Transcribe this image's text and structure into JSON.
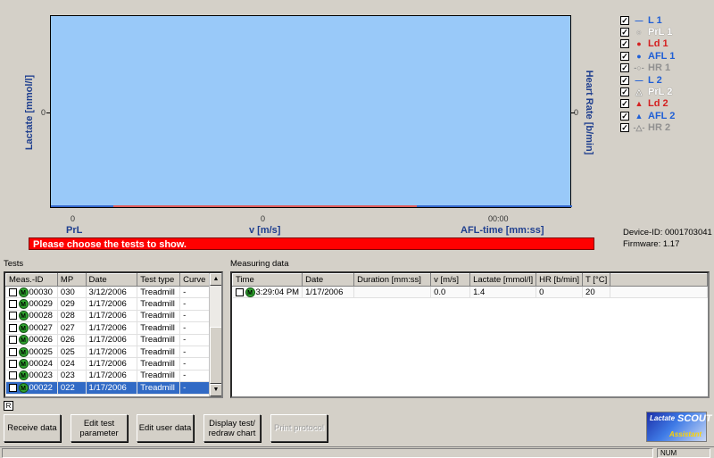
{
  "chart": {
    "ylabel_left": "Lactate [mmol/l]",
    "ylabel_right": "Heart Rate [b/min]",
    "ytick_left": "0",
    "ytick_right": "0",
    "x_axes": [
      {
        "tick": "0",
        "label": "PrL"
      },
      {
        "tick": "0",
        "label": "v [m/s]"
      },
      {
        "tick": "00:00",
        "label": "AFL-time [mm:ss]"
      }
    ],
    "message": "Please choose the tests to show.",
    "colors": {
      "plot_bg": "#99c9f9",
      "message_bg": "#ff0000"
    }
  },
  "legend": [
    {
      "label": "L 1",
      "symbol": "—",
      "color": "#1f5fd6"
    },
    {
      "label": "PrL 1",
      "symbol": "○",
      "color": "#ffffff"
    },
    {
      "label": "Ld 1",
      "symbol": "●",
      "color": "#d42020"
    },
    {
      "label": "AFL 1",
      "symbol": "●",
      "color": "#1f5fd6"
    },
    {
      "label": "HR 1",
      "symbol": "-○-",
      "color": "#909090"
    },
    {
      "label": "L 2",
      "symbol": "—",
      "color": "#1f5fd6"
    },
    {
      "label": "PrL 2",
      "symbol": "△",
      "color": "#ffffff"
    },
    {
      "label": "Ld 2",
      "symbol": "▲",
      "color": "#d42020"
    },
    {
      "label": "AFL 2",
      "symbol": "▲",
      "color": "#1f5fd6"
    },
    {
      "label": "HR 2",
      "symbol": "-△-",
      "color": "#909090"
    }
  ],
  "device": {
    "id_line": "Device-ID: 0001703041",
    "firmware_line": "Firmware: 1.17"
  },
  "tests": {
    "label": "Tests",
    "headers": [
      "Meas.-ID",
      "MP",
      "Date",
      "Test type",
      "Curve"
    ],
    "rows": [
      {
        "id": "00030",
        "mp": "030",
        "date": "3/12/2006",
        "type": "Treadmill",
        "curve": "-"
      },
      {
        "id": "00029",
        "mp": "029",
        "date": "1/17/2006",
        "type": "Treadmill",
        "curve": "-"
      },
      {
        "id": "00028",
        "mp": "028",
        "date": "1/17/2006",
        "type": "Treadmill",
        "curve": "-"
      },
      {
        "id": "00027",
        "mp": "027",
        "date": "1/17/2006",
        "type": "Treadmill",
        "curve": "-"
      },
      {
        "id": "00026",
        "mp": "026",
        "date": "1/17/2006",
        "type": "Treadmill",
        "curve": "-"
      },
      {
        "id": "00025",
        "mp": "025",
        "date": "1/17/2006",
        "type": "Treadmill",
        "curve": "-"
      },
      {
        "id": "00024",
        "mp": "024",
        "date": "1/17/2006",
        "type": "Treadmill",
        "curve": "-"
      },
      {
        "id": "00023",
        "mp": "023",
        "date": "1/17/2006",
        "type": "Treadmill",
        "curve": "-"
      },
      {
        "id": "00022",
        "mp": "022",
        "date": "1/17/2006",
        "type": "Treadmill",
        "curve": "-",
        "selected": true
      }
    ]
  },
  "measuring": {
    "label": "Measuring data",
    "headers": [
      "Time",
      "Date",
      "Duration [mm:ss]",
      "v [m/s]",
      "Lactate [mmol/l]",
      "HR [b/min]",
      "T [°C]"
    ],
    "rows": [
      {
        "time": "3:29:04 PM",
        "date": "1/17/2006",
        "duration": "",
        "v": "0.0",
        "lactate": "1.4",
        "hr": "0",
        "t": "20"
      }
    ]
  },
  "r_box": "R",
  "buttons": {
    "receive": "Receive data",
    "edit_test": "Edit test parameter",
    "edit_user": "Edit user data",
    "display": "Display test/ redraw chart",
    "print": "Print protocol"
  },
  "logo": {
    "line1": "Lactate",
    "line2": "SCOUT",
    "line3": "Assistant"
  },
  "statusbar": {
    "num": "NUM"
  }
}
